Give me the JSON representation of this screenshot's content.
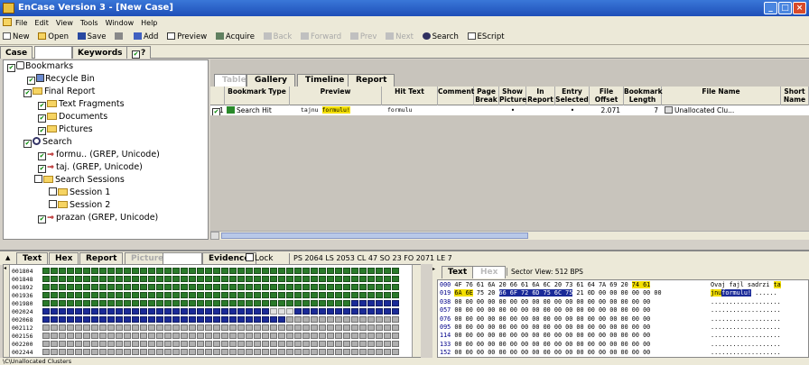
{
  "window": {
    "title": "EnCase Version 3 - [New Case]"
  },
  "menu": [
    "File",
    "Edit",
    "View",
    "Tools",
    "Window",
    "Help"
  ],
  "toolbar": {
    "new": "New",
    "open": "Open",
    "save": "Save",
    "print_blank": "",
    "add": "Add",
    "preview": "Preview",
    "acquire": "Acquire",
    "back": "Back",
    "forward": "Forward",
    "prev": "Prev",
    "next": "Next",
    "search": "Search",
    "escript": "EScript"
  },
  "case_tabs": {
    "case": "Case",
    "hidden": "",
    "keywords": "Keywords",
    "help": "?"
  },
  "tree": {
    "bookmarks": "Bookmarks",
    "recycle": "Recycle Bin",
    "final_report": "Final Report",
    "text_fragments": "Text Fragments",
    "documents": "Documents",
    "pictures": "Pictures",
    "search": "Search",
    "formu": "formu.. (GREP, Unicode)",
    "taj": "taj. (GREP, Unicode)",
    "sessions": "Search Sessions",
    "session1": "Session 1",
    "session2": "Session 2",
    "prazan": "prazan (GREP, Unicode)"
  },
  "right_tabs": [
    "Table",
    "Gallery",
    "Timeline",
    "Report"
  ],
  "columns": [
    "Bookmark Type",
    "Preview",
    "Hit Text",
    "Comment",
    "Page Break",
    "Show Picture",
    "In Report",
    "Entry Selected",
    "File Offset",
    "Bookmark Length",
    "File Name",
    "Short Name"
  ],
  "row": {
    "num": "1",
    "type": "Search Hit",
    "preview_a": "tajnu",
    "preview_b": "formulu!",
    "hit": "formulu",
    "pbreak": "",
    "spic": "•",
    "inrep": "",
    "esel": "•",
    "offset": "2.071",
    "length": "7",
    "fname": "Unallocated Clu..."
  },
  "bottom_tabs": {
    "text": "Text",
    "hex": "Hex",
    "report": "Report",
    "picture": "Picture",
    "blank": "",
    "evidence": "Evidence",
    "lock": "Lock"
  },
  "sector_info": "PS 2064 LS 2053 CL 47 SO 23 FO 2071 LE 7",
  "sector_rows": [
    "001804",
    "001848",
    "001892",
    "001936",
    "001980",
    "002024",
    "002068",
    "002112",
    "002156",
    "002200",
    "002244"
  ],
  "text_tabs": {
    "text": "Text",
    "hex": "Hex",
    "sector_view": "Sector View: 512 BPS"
  },
  "hex_rows": [
    {
      "off": "000",
      "pre": "4F 76 61 6A 20 66 61 6A 6C 20 73 61 64 7A 69 20 ",
      "hi": "74 61",
      "post": "",
      "asc_pre": "Ovaj fajl sadrzi ",
      "asc_hi": "ta",
      "asc_post": ""
    },
    {
      "off": "019",
      "pre": "",
      "hi": "6A 6E",
      "mid": " 75 20 ",
      "sel": "66 6F 72 6D 75 6C 75",
      "post": " 21 0D 00 00 00 00 00 00",
      "asc_pre": "",
      "asc_hi": "jnu",
      "asc_sel": "formulu!",
      "asc_post": " ......"
    },
    {
      "off": "038",
      "pre": "00 00 00 00 00 00 00 00 00 00 00 00 00 00 00 00 00 00",
      "asc_pre": "..................."
    },
    {
      "off": "057",
      "pre": "00 00 00 00 00 00 00 00 00 00 00 00 00 00 00 00 00 00",
      "asc_pre": "..................."
    },
    {
      "off": "076",
      "pre": "00 00 00 00 00 00 00 00 00 00 00 00 00 00 00 00 00 00",
      "asc_pre": "..................."
    },
    {
      "off": "095",
      "pre": "00 00 00 00 00 00 00 00 00 00 00 00 00 00 00 00 00 00",
      "asc_pre": "..................."
    },
    {
      "off": "114",
      "pre": "00 00 00 00 00 00 00 00 00 00 00 00 00 00 00 00 00 00",
      "asc_pre": "..................."
    },
    {
      "off": "133",
      "pre": "00 00 00 00 00 00 00 00 00 00 00 00 00 00 00 00 00 00",
      "asc_pre": "..................."
    },
    {
      "off": "152",
      "pre": "00 00 00 00 00 00 00 00 00 00 00 00 00 00 00 00 00 00",
      "asc_pre": "..................."
    }
  ],
  "status": "\\C\\Unallocated Clusters",
  "colors": {
    "title_blue": "#1e4fb8",
    "grid_green": "#2a7a2a",
    "grid_blue": "#1a2a98",
    "grid_gray": "#b0b0b0",
    "highlight": "#f4e000"
  }
}
